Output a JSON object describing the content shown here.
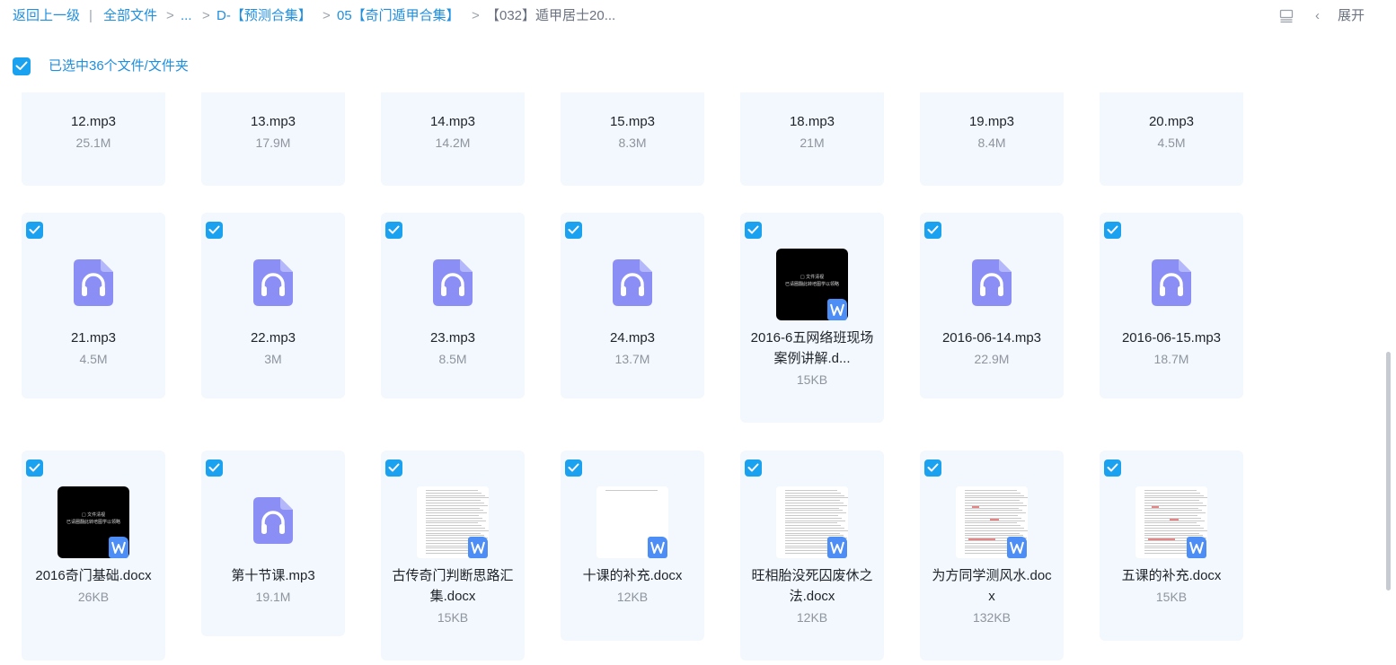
{
  "breadcrumb": {
    "back": "返回上一级",
    "divider": "|",
    "all_files": "全部文件",
    "ellipsis": "...",
    "level1": "D-【预测合集】",
    "level2": "05【奇门遁甲合集】",
    "current": "【032】遁甲居士20..."
  },
  "toolbar": {
    "list_view_icon": "list-view-icon",
    "expand_chevron": "‹",
    "expand_label": "展开"
  },
  "selection": {
    "text": "已选中36个文件/文件夹",
    "checked": true
  },
  "colors": {
    "accent": "#1aa1f0",
    "link": "#1f8fde",
    "card_bg": "#f2f8fd",
    "audio_icon": "#8b8ff5",
    "doc_badge": "#4c8df6"
  },
  "doc_thumb_text": {
    "line1": "□ 文件清视",
    "line2": "已请圈翻此转培图学以领略"
  },
  "files": [
    {
      "name": "12.mp3",
      "size": "25.1M",
      "type": "audio"
    },
    {
      "name": "13.mp3",
      "size": "17.9M",
      "type": "audio"
    },
    {
      "name": "14.mp3",
      "size": "14.2M",
      "type": "audio"
    },
    {
      "name": "15.mp3",
      "size": "8.3M",
      "type": "audio"
    },
    {
      "name": "18.mp3",
      "size": "21M",
      "type": "audio"
    },
    {
      "name": "19.mp3",
      "size": "8.4M",
      "type": "audio"
    },
    {
      "name": "20.mp3",
      "size": "4.5M",
      "type": "audio"
    },
    {
      "name": "21.mp3",
      "size": "4.5M",
      "type": "audio"
    },
    {
      "name": "22.mp3",
      "size": "3M",
      "type": "audio"
    },
    {
      "name": "23.mp3",
      "size": "8.5M",
      "type": "audio"
    },
    {
      "name": "24.mp3",
      "size": "13.7M",
      "type": "audio"
    },
    {
      "name": "2016-6五网络班现场案例讲解.d...",
      "size": "15KB",
      "type": "doc-dark"
    },
    {
      "name": "2016-06-14.mp3",
      "size": "22.9M",
      "type": "audio"
    },
    {
      "name": "2016-06-15.mp3",
      "size": "18.7M",
      "type": "audio"
    },
    {
      "name": "2016奇门基础.docx",
      "size": "26KB",
      "type": "doc-dark"
    },
    {
      "name": "第十节课.mp3",
      "size": "19.1M",
      "type": "audio"
    },
    {
      "name": "古传奇门判断思路汇集.docx",
      "size": "15KB",
      "type": "doc-page"
    },
    {
      "name": "十课的补充.docx",
      "size": "12KB",
      "type": "doc-page-sparse"
    },
    {
      "name": "旺相胎没死囚废休之法.docx",
      "size": "12KB",
      "type": "doc-page"
    },
    {
      "name": "为方同学测风水.docx",
      "size": "132KB",
      "type": "doc-page-red"
    },
    {
      "name": "五课的补充.docx",
      "size": "15KB",
      "type": "doc-page-red"
    }
  ]
}
